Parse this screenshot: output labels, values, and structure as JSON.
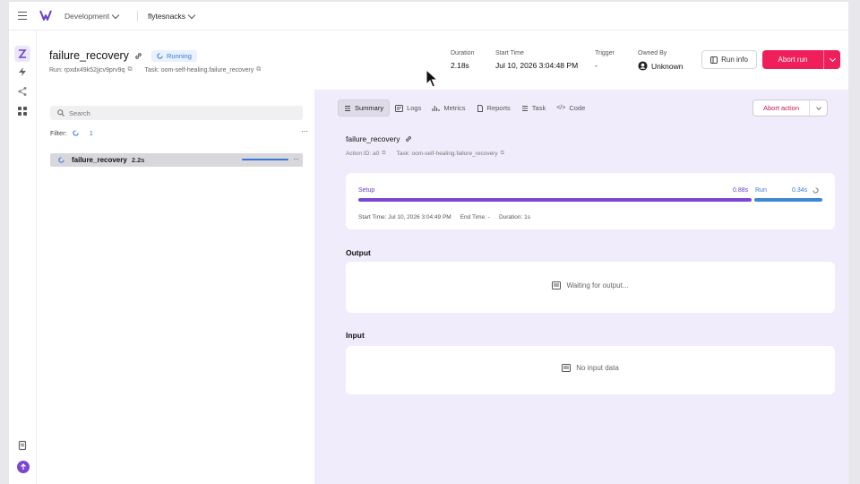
{
  "topbar": {
    "domain_label": "Development",
    "project_label": "flytesnacks"
  },
  "run": {
    "title": "failure_recovery",
    "status": "Running",
    "run_id_label": "Run: rpxdx49k52jjcv9prv9q",
    "task_label": "Task: oom-self-healing.failure_recovery"
  },
  "meta": {
    "duration_key": "Duration",
    "duration_val": "2.18s",
    "start_key": "Start Time",
    "start_val": "Jul 10, 2026 3:04:48 PM",
    "trigger_key": "Trigger",
    "trigger_val": "-",
    "owner_key": "Owned By",
    "owner_val": "Unknown"
  },
  "buttons": {
    "run_info": "Run info",
    "abort_run": "Abort run",
    "abort_action": "Abort action"
  },
  "left": {
    "search_placeholder": "Search",
    "filter_label": "Filter:",
    "filter_count": "1",
    "rows": [
      {
        "name": "failure_recovery",
        "duration": "2.2s"
      }
    ]
  },
  "tabs": [
    {
      "label": "Summary",
      "icon": "summary-icon"
    },
    {
      "label": "Logs",
      "icon": "logs-icon"
    },
    {
      "label": "Metrics",
      "icon": "metrics-icon"
    },
    {
      "label": "Reports",
      "icon": "reports-icon"
    },
    {
      "label": "Task",
      "icon": "task-icon"
    },
    {
      "label": "Code",
      "icon": "code-icon"
    }
  ],
  "action": {
    "title": "failure_recovery",
    "action_id": "Action ID: a0",
    "task": "Task: oom-self-healing.failure_recovery"
  },
  "timeline": {
    "setup_label": "Setup",
    "setup_duration": "0.88s",
    "run_label": "Run",
    "run_duration": "0.34s",
    "start_time": "Start Time: Jul 10, 2026 3:04:49 PM",
    "end_time": "End Time: -",
    "duration": "Duration: 1s"
  },
  "output": {
    "label": "Output",
    "empty_text": "Waiting for output..."
  },
  "input": {
    "label": "Input",
    "empty_text": "No input data"
  },
  "colors": {
    "accent_purple": "#7b46d0",
    "abort_red": "#ef1f5c",
    "running_blue": "#3a78d8",
    "panel_bg": "#f1ecfb"
  }
}
